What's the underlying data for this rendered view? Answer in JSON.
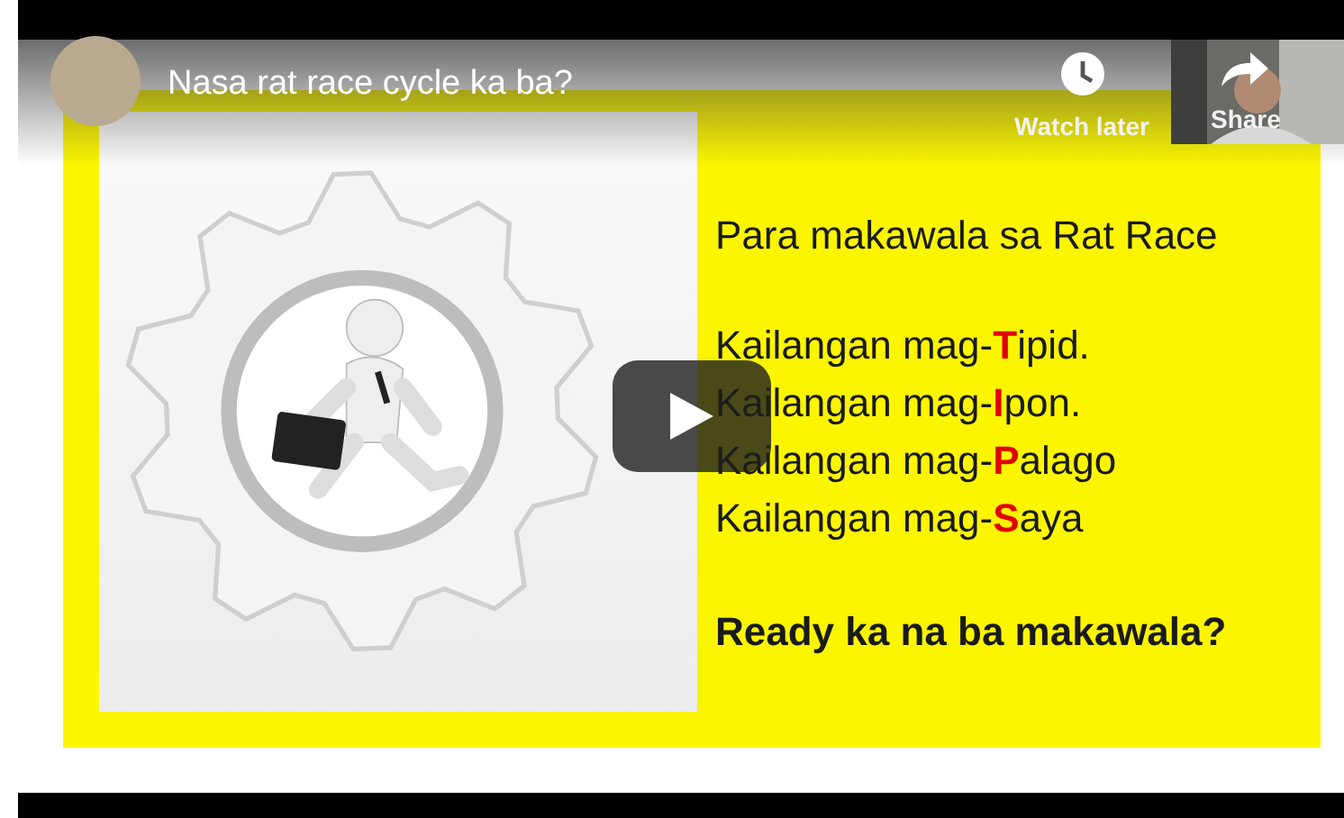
{
  "video": {
    "title": "Nasa rat race cycle ka ba?",
    "actions": [
      {
        "kind": "watch_later",
        "label": "Watch later"
      },
      {
        "kind": "share",
        "label": "Share"
      }
    ],
    "slide": {
      "heading": "Para makawala sa Rat Race",
      "lines": [
        {
          "prefix": "Kailangan mag-",
          "initial": "T",
          "rest": "ipid."
        },
        {
          "prefix": "Kailangan mag-",
          "initial": "I",
          "rest": "pon."
        },
        {
          "prefix": "Kailangan mag-",
          "initial": "P",
          "rest": "alago"
        },
        {
          "prefix": "Kailangan mag-",
          "initial": "S",
          "rest": "aya"
        }
      ],
      "closing": "Ready ka na ba makawala?"
    }
  }
}
